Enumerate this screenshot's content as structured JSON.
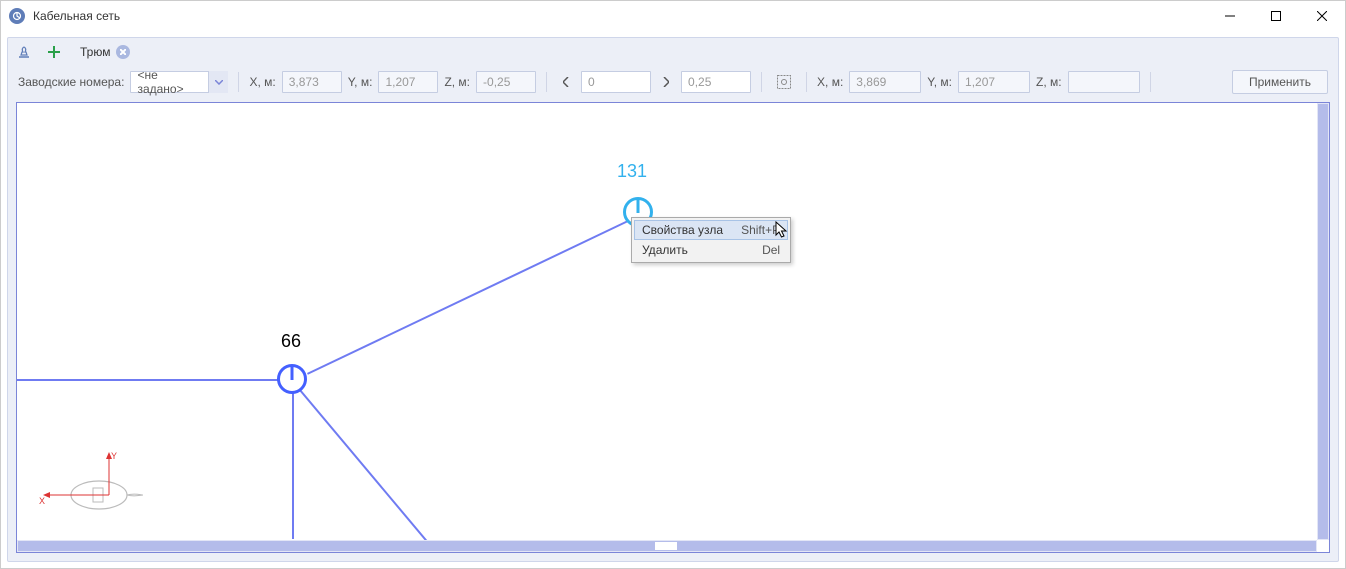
{
  "window": {
    "title": "Кабельная сеть"
  },
  "tabs": {
    "name": "Трюм"
  },
  "toolbar": {
    "serial_label": "Заводские номера:",
    "serial_value": "<не задано>",
    "x1_label": "X, м:",
    "x1_value": "3,873",
    "y1_label": "Y, м:",
    "y1_value": "1,207",
    "z1_label": "Z, м:",
    "z1_value": "-0,25",
    "spin_left": "0",
    "spin_right": "0,25",
    "x2_label": "X, м:",
    "x2_value": "3,869",
    "y2_label": "Y, м:",
    "y2_value": "1,207",
    "z2_label": "Z, м:",
    "z2_value": "",
    "apply": "Применить"
  },
  "diagram": {
    "nodes": {
      "n66": {
        "label": "66"
      },
      "n131": {
        "label": "131"
      }
    }
  },
  "context_menu": {
    "items": [
      {
        "label": "Свойства узла",
        "shortcut": "Shift+P"
      },
      {
        "label": "Удалить",
        "shortcut": "Del"
      }
    ]
  }
}
